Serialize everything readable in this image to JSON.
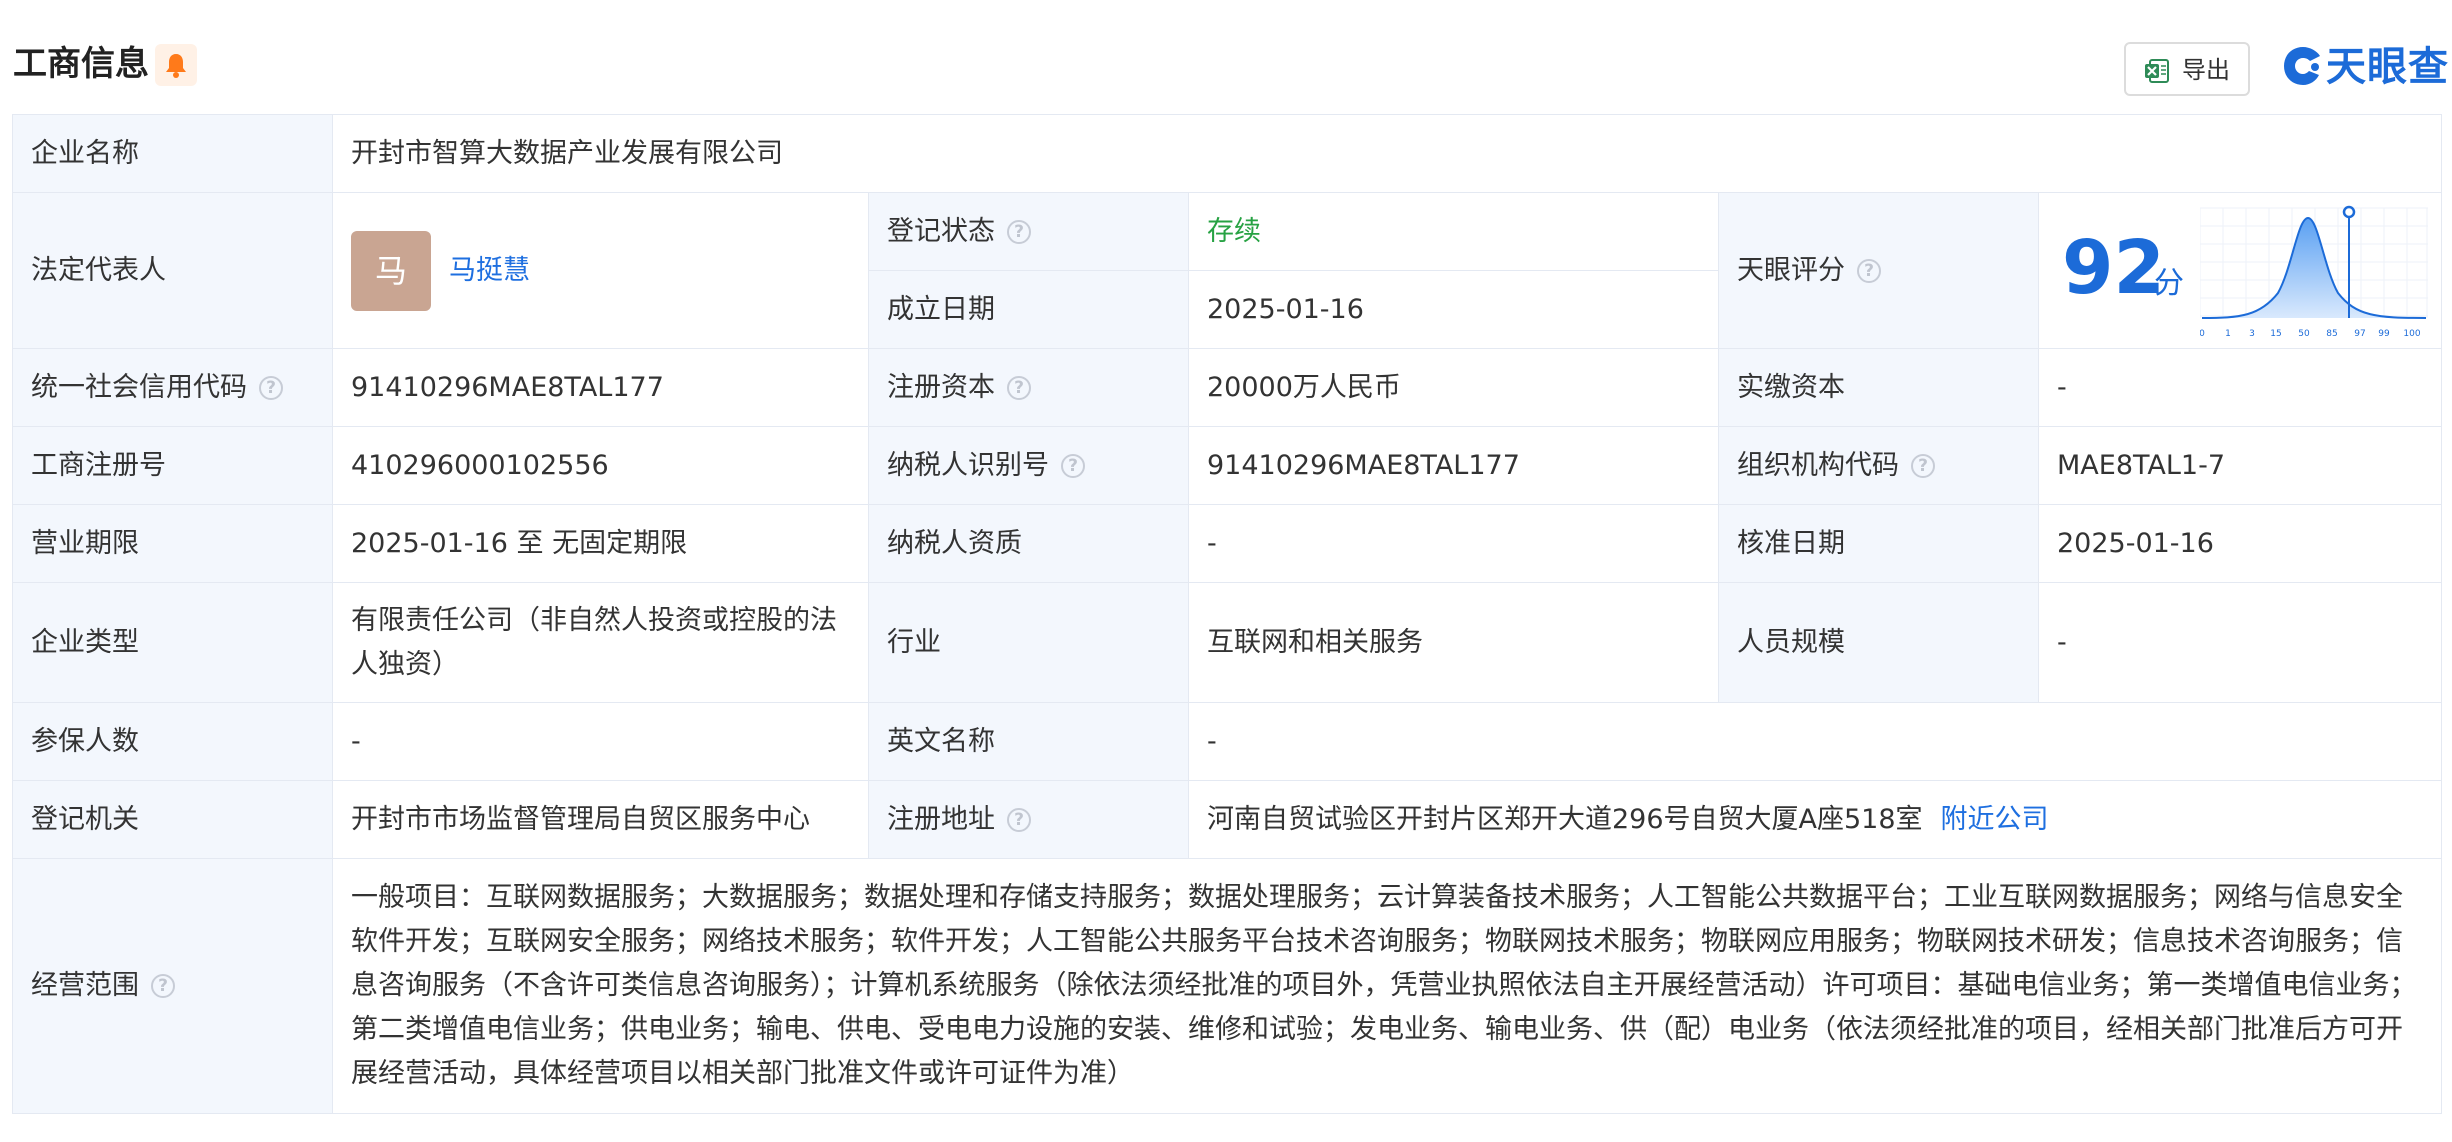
{
  "header": {
    "title": "工商信息",
    "export_label": "导出",
    "brand": "天眼查"
  },
  "colors": {
    "accent": "#1c6bd8",
    "status_green": "#27a243",
    "label_bg": "#f3f7fd",
    "bell": "#ff7a1a"
  },
  "icons": {
    "bell": "bell-icon",
    "export": "excel-icon",
    "help": "question-icon",
    "brand": "tianyancha-logo-icon"
  },
  "labels": {
    "company_name": "企业名称",
    "legal_rep": "法定代表人",
    "reg_status": "登记状态",
    "found_date": "成立日期",
    "tianyan_score": "天眼评分",
    "credit_code": "统一社会信用代码",
    "reg_capital": "注册资本",
    "paid_capital": "实缴资本",
    "biz_reg_no": "工商注册号",
    "taxpayer_id": "纳税人识别号",
    "org_code": "组织机构代码",
    "biz_term": "营业期限",
    "taxpayer_qual": "纳税人资质",
    "approval_date": "核准日期",
    "company_type": "企业类型",
    "industry": "行业",
    "staff_size": "人员规模",
    "insured": "参保人数",
    "english_name": "英文名称",
    "reg_authority": "登记机关",
    "reg_address": "注册地址",
    "biz_scope": "经营范围"
  },
  "values": {
    "company_name": "开封市智算大数据产业发展有限公司",
    "legal_rep_avatar": "马",
    "legal_rep": "马挺慧",
    "reg_status": "存续",
    "found_date": "2025-01-16",
    "score": "92",
    "score_unit": "分",
    "credit_code": "91410296MAE8TAL177",
    "reg_capital": "20000万人民币",
    "paid_capital": "-",
    "biz_reg_no": "410296000102556",
    "taxpayer_id": "91410296MAE8TAL177",
    "org_code": "MAE8TAL1-7",
    "biz_term": "2025-01-16 至 无固定期限",
    "taxpayer_qual": "-",
    "approval_date": "2025-01-16",
    "company_type": "有限责任公司（非自然人投资或控股的法人独资）",
    "industry": "互联网和相关服务",
    "staff_size": "-",
    "insured": "-",
    "english_name": "-",
    "reg_authority": "开封市市场监督管理局自贸区服务中心",
    "reg_address": "河南自贸试验区开封片区郑开大道296号自贸大厦A座518室",
    "nearby_link": "附近公司",
    "biz_scope": "一般项目：互联网数据服务；大数据服务；数据处理和存储支持服务；数据处理服务；云计算装备技术服务；人工智能公共数据平台；工业互联网数据服务；网络与信息安全软件开发；互联网安全服务；网络技术服务；软件开发；人工智能公共服务平台技术咨询服务；物联网技术服务；物联网应用服务；物联网技术研发；信息技术咨询服务；信息咨询服务（不含许可类信息咨询服务）；计算机系统服务（除依法须经批准的项目外，凭营业执照依法自主开展经营活动）许可项目：基础电信业务；第一类增值电信业务；第二类增值电信业务；供电业务；输电、供电、受电电力设施的安装、维修和试验；发电业务、输电业务、供（配）电业务（依法须经批准的项目，经相关部门批准后方可开展经营活动，具体经营项目以相关部门批准文件或许可证件为准）"
  },
  "score_chart": {
    "ticks": [
      "0",
      "1",
      "3",
      "15",
      "50",
      "85",
      "97",
      "99",
      "100"
    ],
    "marker_percentile": 92
  }
}
